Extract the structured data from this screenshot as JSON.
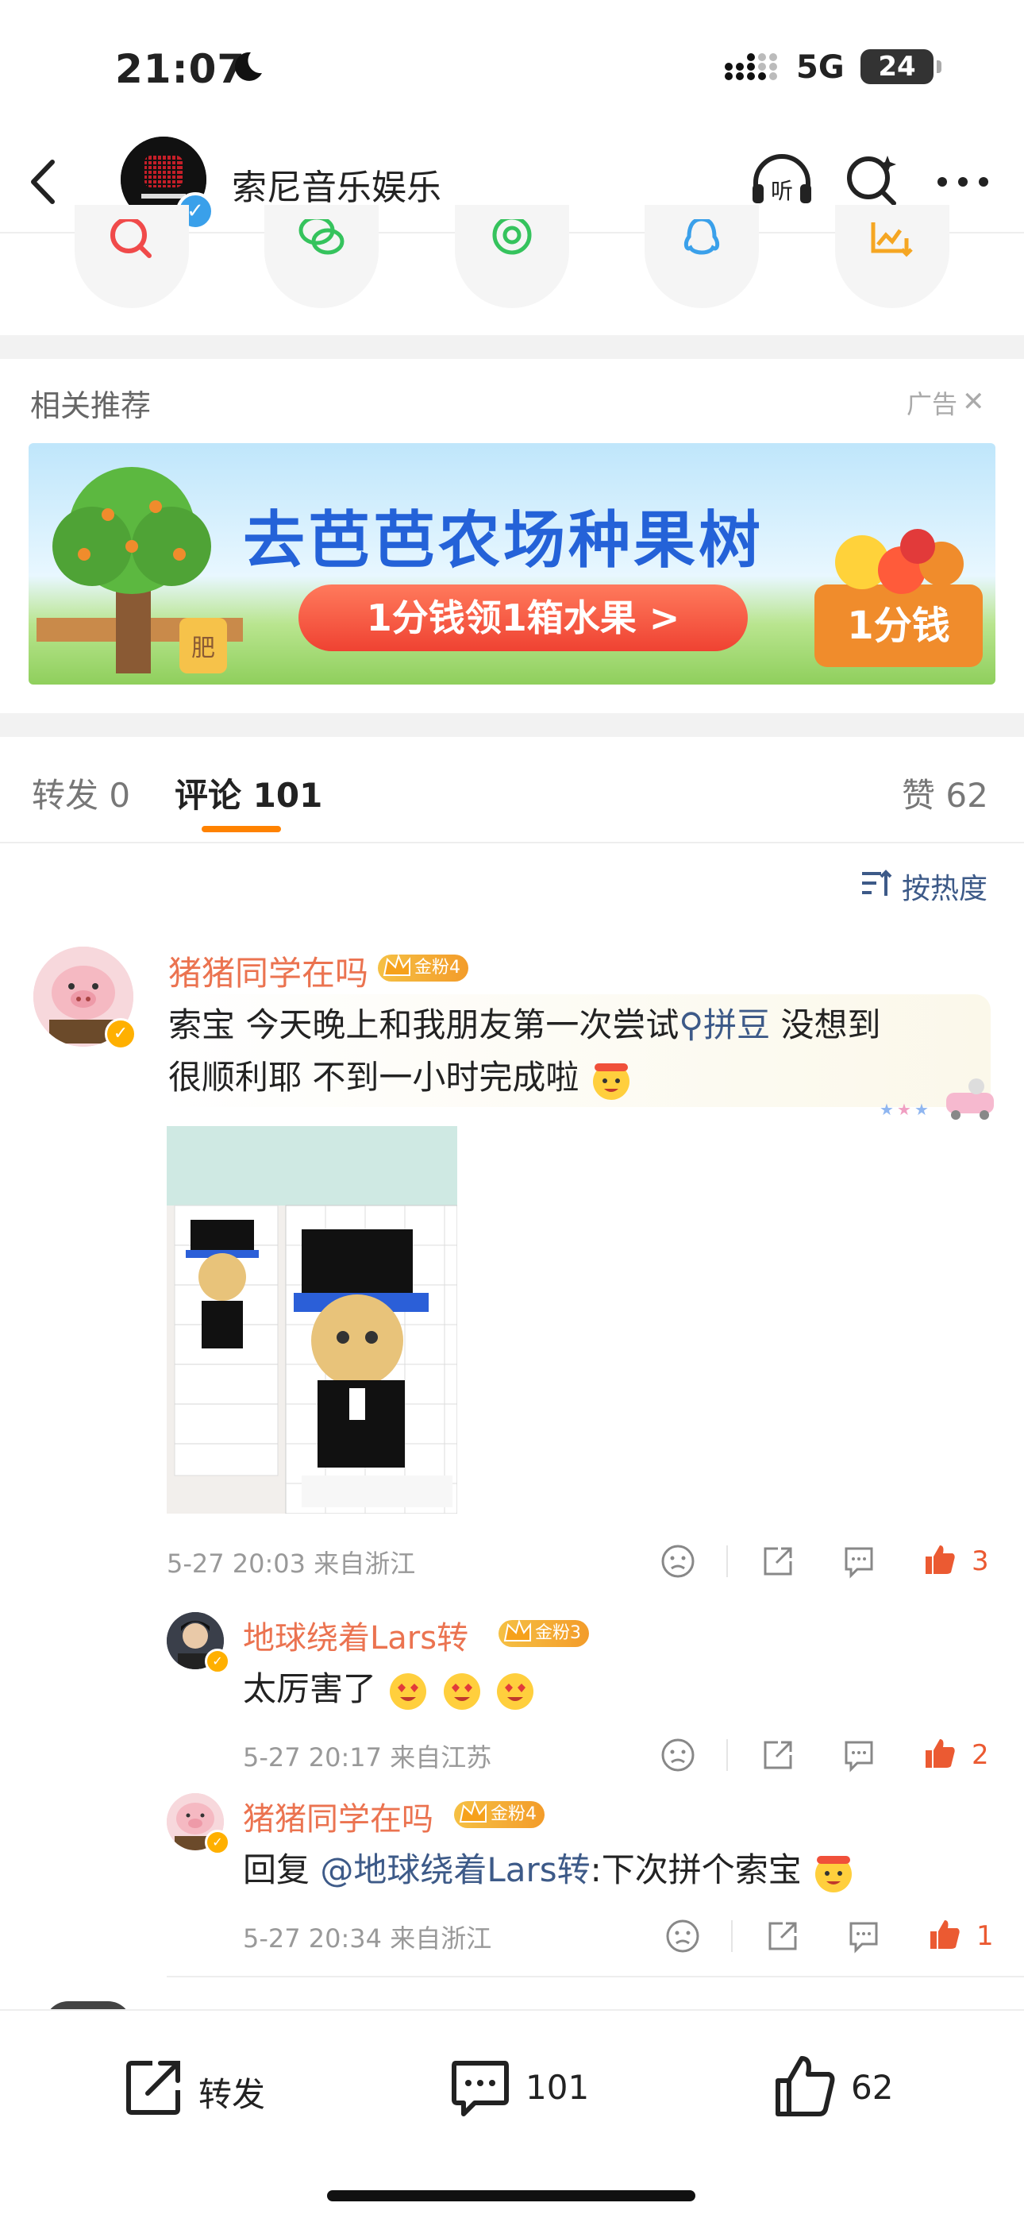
{
  "status_bar": {
    "time": "21:07",
    "network": "5G",
    "battery": "24"
  },
  "header": {
    "account_name": "索尼音乐娱乐"
  },
  "related": {
    "title": "相关推荐",
    "ad_label": "广告",
    "ad_close": "✕"
  },
  "ad_banner": {
    "title": "去芭芭农场种果树",
    "button": "1分钱领1箱水果 >",
    "tag": "1分钱",
    "pot_label": "肥"
  },
  "tabs": {
    "repost": "转发 0",
    "comment": "评论 101",
    "like": "赞 62"
  },
  "sort": {
    "label": "按热度"
  },
  "comments": [
    {
      "user": "猪猪同学在吗",
      "fan_badge": "金粉4",
      "text_before": "索宝 今天晚上和我朋友第一次尝试",
      "topic_link": "拼豆",
      "text_line1_end": " 没想到",
      "text_line2": "很顺利耶 不到一小时完成啦",
      "time": "5-27 20:03",
      "location": "来自浙江",
      "likes": "3",
      "replies": [
        {
          "user": "地球绕着Lars转",
          "fan_badge": "金粉3",
          "text": "太厉害了",
          "time": "5-27 20:17",
          "location": "来自江苏",
          "likes": "2"
        },
        {
          "user": "猪猪同学在吗",
          "fan_badge": "金粉4",
          "reply_prefix": "回复 ",
          "mention": "@地球绕着Lars转",
          "text": ":下次拼个索宝",
          "time": "5-27 20:34",
          "location": "来自浙江",
          "likes": "1"
        }
      ]
    }
  ],
  "bottom_bar": {
    "repost": "转发",
    "comment_count": "101",
    "like_count": "62"
  },
  "colors": {
    "accent": "#ff8200",
    "username": "#eb7350",
    "link": "#3d5a88",
    "like": "#eb5a32"
  }
}
